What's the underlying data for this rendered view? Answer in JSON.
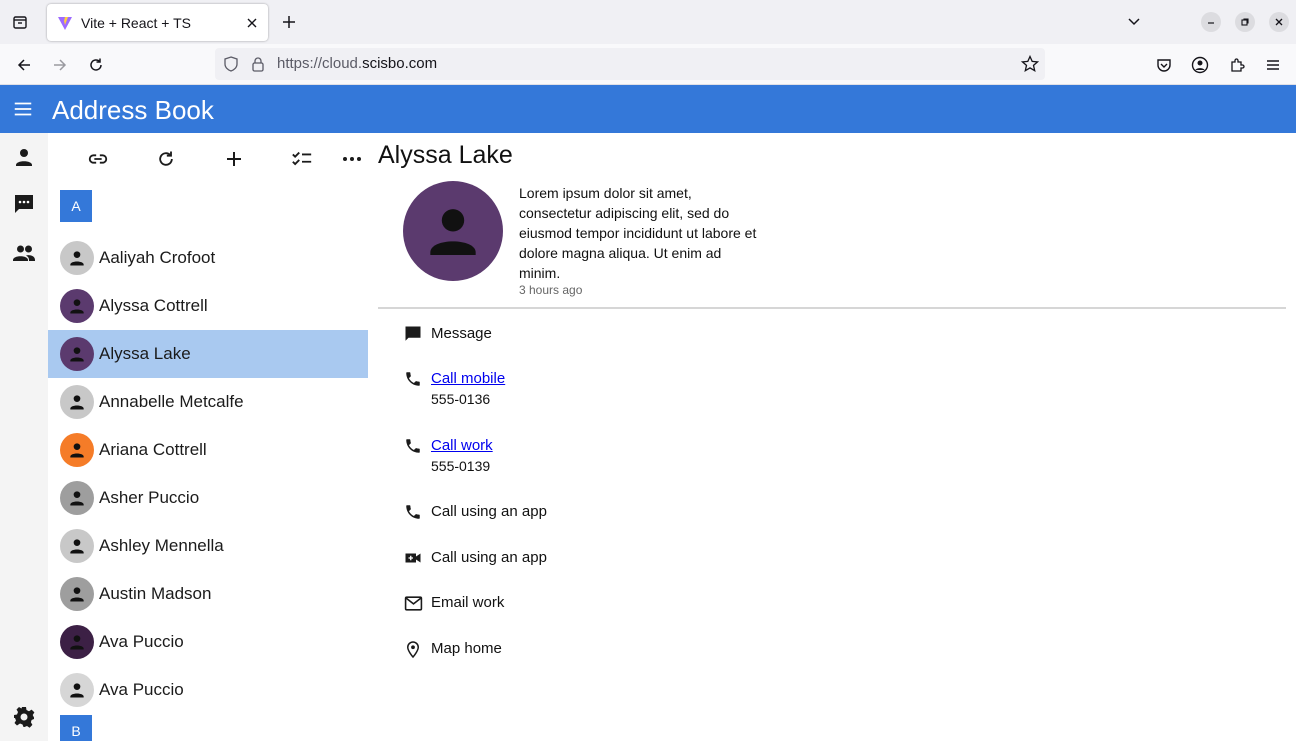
{
  "browser": {
    "tab_title": "Vite + React + TS",
    "url_prefix": "https://cloud.",
    "url_domain": "scisbo.com",
    "window_controls": [
      "minimize",
      "restore",
      "close"
    ]
  },
  "app": {
    "title": "Address Book",
    "accent_color": "#3478d9",
    "selected_color": "#a9c9f0"
  },
  "siderail": {
    "items": [
      {
        "icon": "person-icon"
      },
      {
        "icon": "message-icon"
      },
      {
        "icon": "group-icon"
      }
    ],
    "settings_icon": "gear-icon"
  },
  "toolbar": {
    "buttons": [
      "link-icon",
      "refresh-icon",
      "add-icon",
      "checklist-icon",
      "more-icon"
    ]
  },
  "contacts": {
    "section_a": "A",
    "section_b": "B",
    "items": [
      {
        "name": "Aaliyah Crofoot",
        "avatar_color": "#c8c8c8"
      },
      {
        "name": "Alyssa Cottrell",
        "avatar_color": "#5b3a6e"
      },
      {
        "name": "Alyssa Lake",
        "avatar_color": "#5b3a6e",
        "selected": true
      },
      {
        "name": "Annabelle Metcalfe",
        "avatar_color": "#c8c8c8"
      },
      {
        "name": "Ariana Cottrell",
        "avatar_color": "#f57c28"
      },
      {
        "name": "Asher Puccio",
        "avatar_color": "#9e9e9e"
      },
      {
        "name": "Ashley Mennella",
        "avatar_color": "#c8c8c8"
      },
      {
        "name": "Austin Madson",
        "avatar_color": "#9e9e9e"
      },
      {
        "name": "Ava Puccio",
        "avatar_color": "#3c2045"
      },
      {
        "name": "Ava Puccio",
        "avatar_color": "#d6d6d6"
      }
    ]
  },
  "detail": {
    "name": "Alyssa Lake",
    "bio": "Lorem ipsum dolor sit amet, consectetur adipiscing elit, sed do eiusmod tempor incididunt ut labore et dolore magna aliqua. Ut enim ad minim.",
    "timestamp": "3 hours ago",
    "actions": {
      "message": "Message",
      "call_mobile": "Call mobile",
      "mobile_number": "555-0136",
      "call_work": "Call work",
      "work_number": "555-0139",
      "call_app_1": "Call using an app",
      "call_app_2": "Call using an app",
      "email_work": "Email work",
      "map_home": "Map home"
    }
  }
}
